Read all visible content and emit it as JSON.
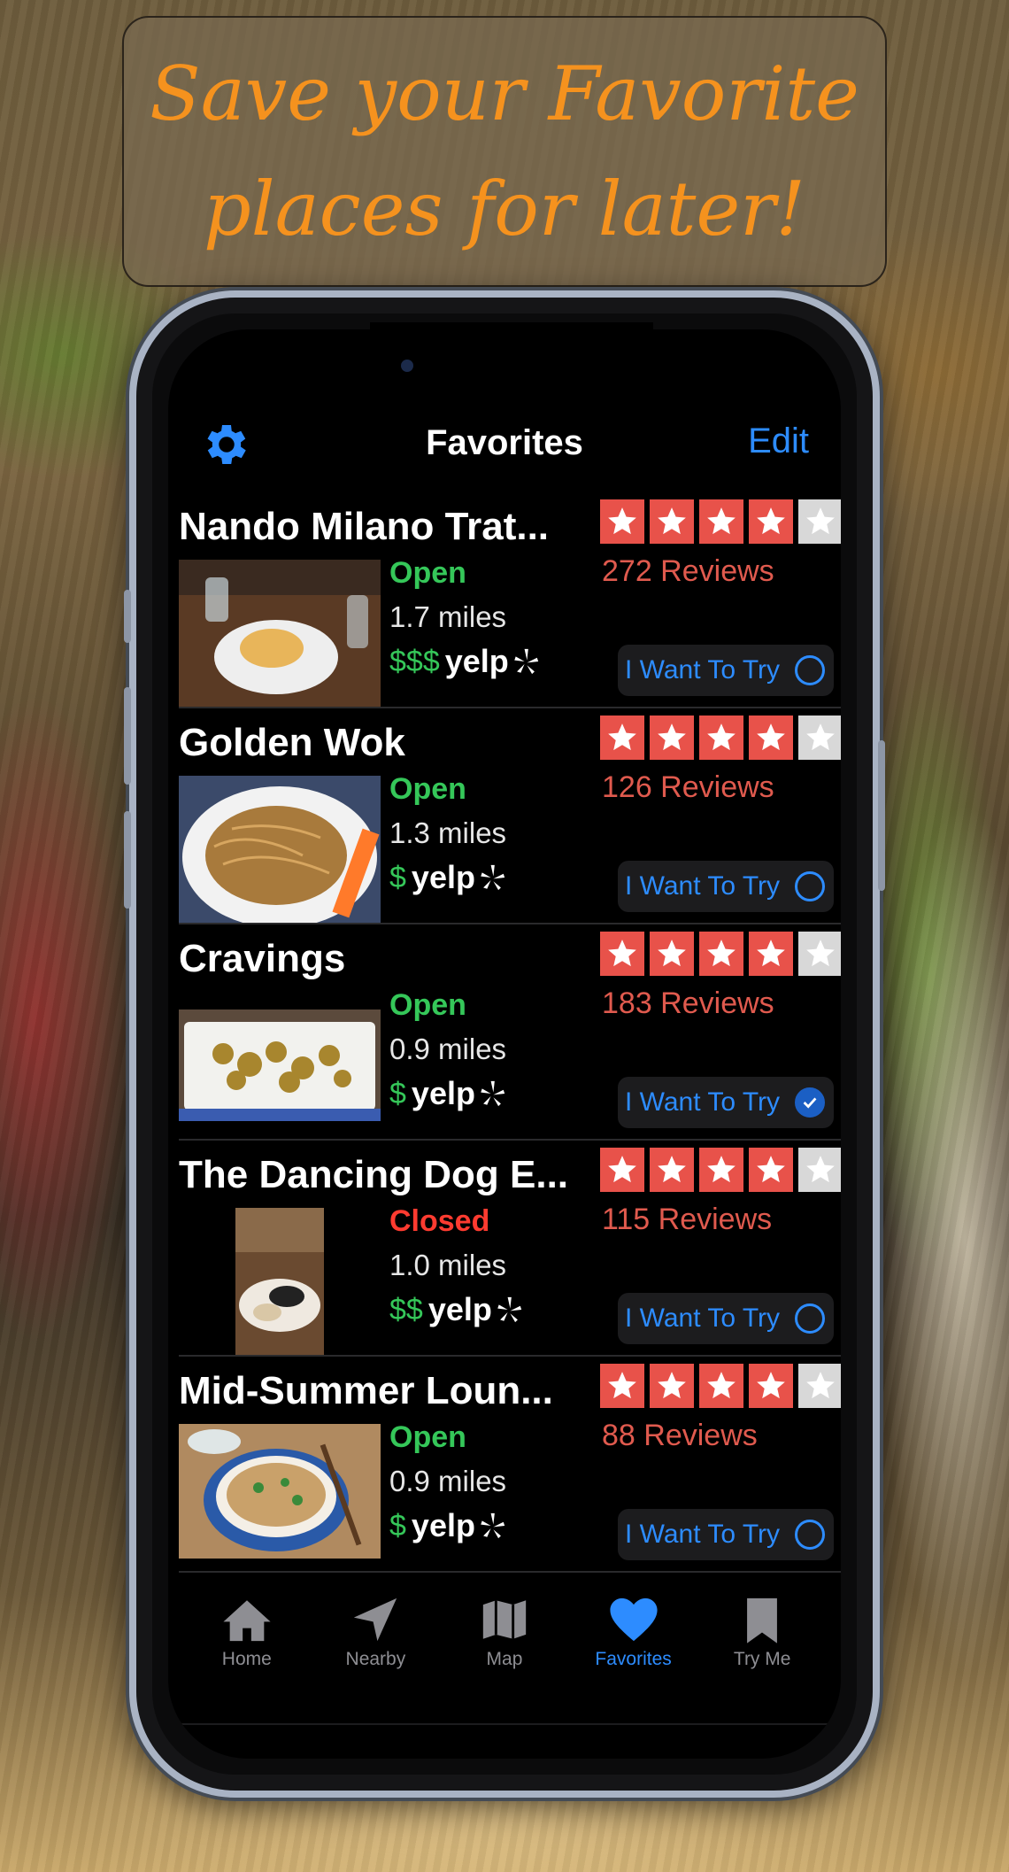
{
  "banner": {
    "line1": "Save your Favorite",
    "line2": "places for later!"
  },
  "nav": {
    "title": "Favorites",
    "edit_label": "Edit",
    "settings_icon": "gear-icon"
  },
  "colors": {
    "accent": "#2d8cff",
    "open": "#35c759",
    "closed": "#ff3b30",
    "star": "#e8524a",
    "banner_text": "#f5921e"
  },
  "favorites": [
    {
      "name": "Nando Milano Trat...",
      "rating": 4,
      "reviews": "272 Reviews",
      "status": "Open",
      "distance": "1.7 miles",
      "price": "$$$",
      "yelp": "yelp",
      "try_label": "I Want To Try",
      "want_to_try": false
    },
    {
      "name": "Golden Wok",
      "rating": 4,
      "reviews": "126 Reviews",
      "status": "Open",
      "distance": "1.3 miles",
      "price": "$",
      "yelp": "yelp",
      "try_label": "I Want To Try",
      "want_to_try": false
    },
    {
      "name": "Cravings",
      "rating": 4,
      "reviews": "183 Reviews",
      "status": "Open",
      "distance": "0.9 miles",
      "price": "$",
      "yelp": "yelp",
      "try_label": "I Want To Try",
      "want_to_try": true
    },
    {
      "name": "The Dancing Dog E...",
      "rating": 4,
      "reviews": "115 Reviews",
      "status": "Closed",
      "distance": "1.0 miles",
      "price": "$$",
      "yelp": "yelp",
      "try_label": "I Want To Try",
      "want_to_try": false
    },
    {
      "name": "Mid-Summer Loun...",
      "rating": 4,
      "reviews": "88 Reviews",
      "status": "Open",
      "distance": "0.9 miles",
      "price": "$",
      "yelp": "yelp",
      "try_label": "I Want To Try",
      "want_to_try": false
    }
  ],
  "tabs": [
    {
      "label": "Home",
      "icon": "house-icon",
      "active": false
    },
    {
      "label": "Nearby",
      "icon": "location-arrow-icon",
      "active": false
    },
    {
      "label": "Map",
      "icon": "map-icon",
      "active": false
    },
    {
      "label": "Favorites",
      "icon": "heart-icon",
      "active": true
    },
    {
      "label": "Try Me",
      "icon": "bookmark-icon",
      "active": false
    }
  ]
}
